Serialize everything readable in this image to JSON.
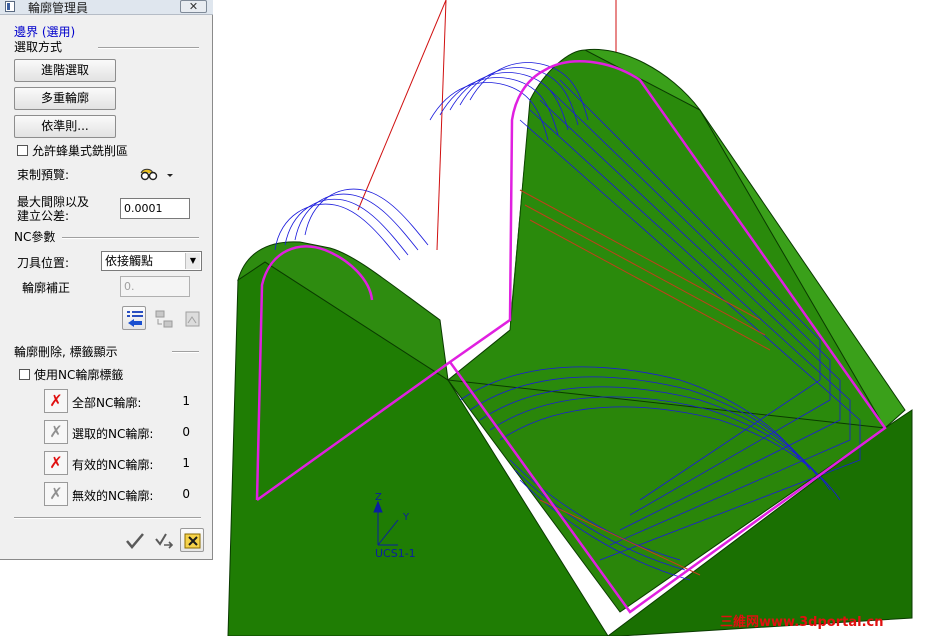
{
  "dialog": {
    "title": "輪廓管理員",
    "close_glyph": "✕",
    "boundary_header": "邊界 (選用)",
    "selection_method_header": "選取方式",
    "buttons": {
      "advanced_select": "進階選取",
      "multi_contour": "多重輪廓",
      "by_rule": "依準則..."
    },
    "allow_pocket_label": "允許蜂巢式銑削區",
    "constraint_preview_label": "束制預覽:",
    "max_gap_label_line1": "最大間隙以及",
    "max_gap_label_line2": "建立公差:",
    "max_gap_value": "0.0001",
    "nc_params_header": "NC參數",
    "tool_position_label": "刀具位置:",
    "tool_position_value": "依接觸點",
    "contour_offset_label": "輪廓補正",
    "contour_offset_value": "0.",
    "delete_section_header": "輪廓刪除, 標籤顯示",
    "use_nc_tags_label": "使用NC輪廓標籤",
    "nc_rows": [
      {
        "label": "全部NC輪廓:",
        "count": "1",
        "active": true
      },
      {
        "label": "選取的NC輪廓:",
        "count": "0",
        "active": false
      },
      {
        "label": "有效的NC輪廓:",
        "count": "1",
        "active": true
      },
      {
        "label": "無效的NC輪廓:",
        "count": "0",
        "active": false
      }
    ]
  },
  "viewport": {
    "axis_z": "Z",
    "axis_y": "Y",
    "ucs_label": "UCS1-1",
    "model_color": "#1e7a00",
    "boundary_color": "#e020e0",
    "toolpath_color": "#1a1adc"
  },
  "watermark": "三維网www.3dportal.cn"
}
